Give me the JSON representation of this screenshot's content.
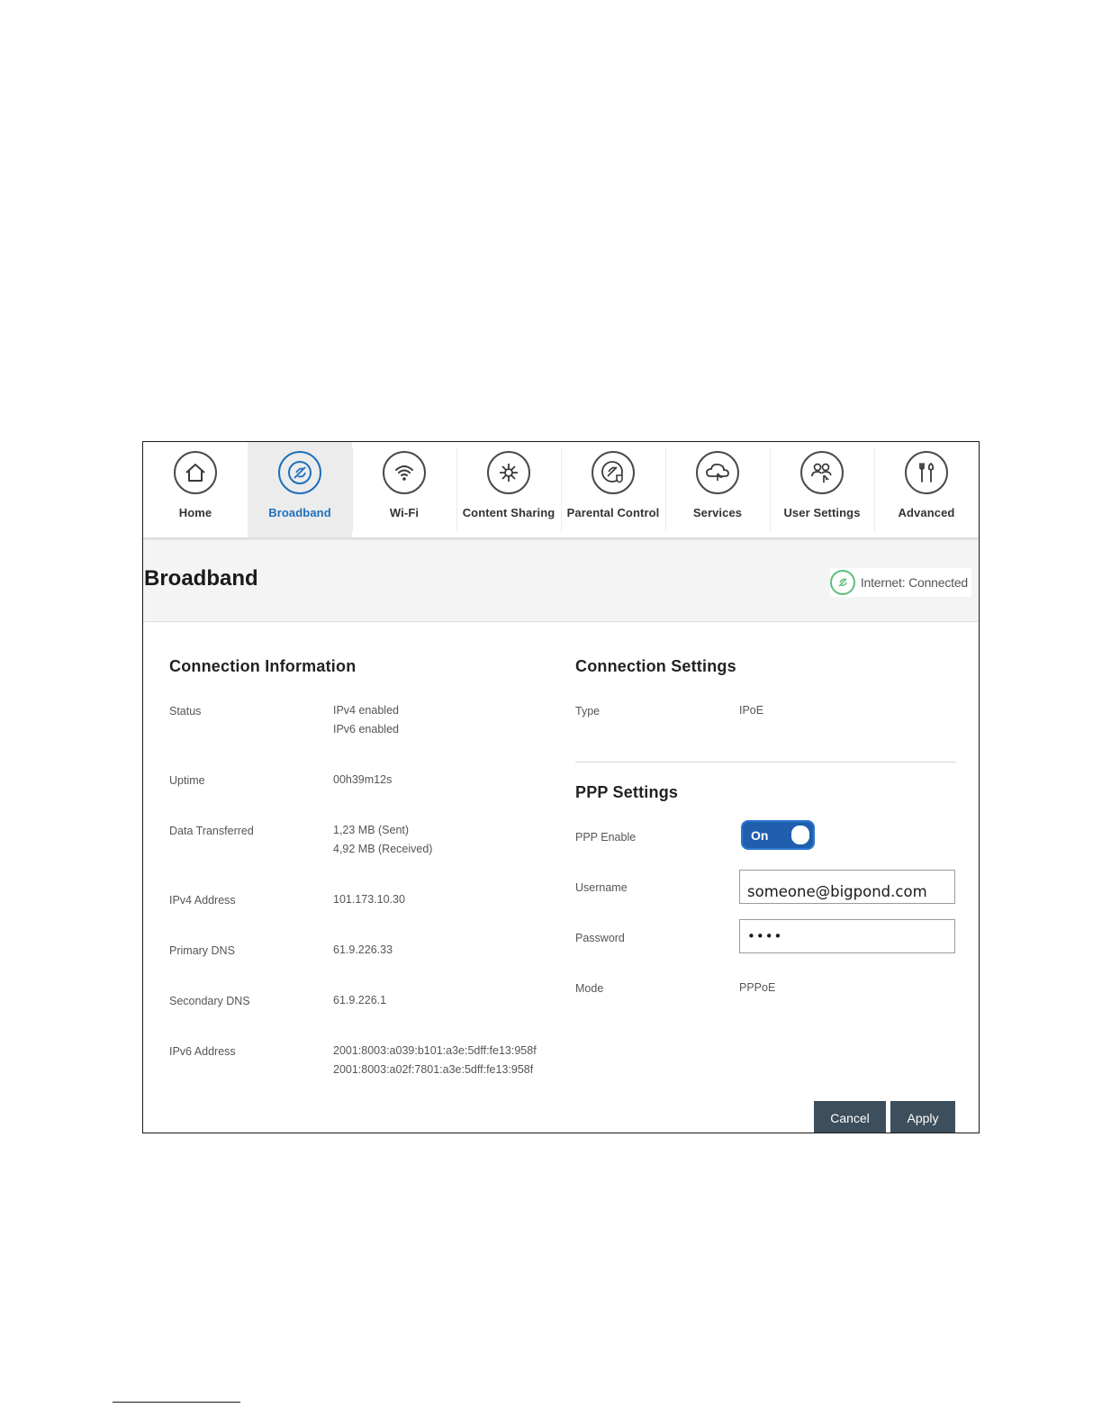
{
  "nav": {
    "items": [
      {
        "label": "Home",
        "icon": "home-icon",
        "active": false
      },
      {
        "label": "Broadband",
        "icon": "broadband-icon",
        "active": true
      },
      {
        "label": "Wi-Fi",
        "icon": "wifi-icon",
        "active": false
      },
      {
        "label": "Content Sharing",
        "icon": "content-sharing-icon",
        "active": false
      },
      {
        "label": "Parental Control",
        "icon": "parental-control-icon",
        "active": false
      },
      {
        "label": "Services",
        "icon": "services-icon",
        "active": false
      },
      {
        "label": "User Settings",
        "icon": "user-settings-icon",
        "active": false
      },
      {
        "label": "Advanced",
        "icon": "advanced-icon",
        "active": false
      }
    ]
  },
  "header": {
    "title": "Broadband",
    "status_text": "Internet: Connected"
  },
  "connection_info": {
    "title": "Connection Information",
    "rows": [
      {
        "label": "Status",
        "values": [
          "IPv4 enabled",
          "IPv6 enabled"
        ]
      },
      {
        "label": "Uptime",
        "values": [
          "00h39m12s"
        ]
      },
      {
        "label": "Data Transferred",
        "values": [
          "1,23 MB (Sent)",
          "4,92 MB (Received)"
        ]
      },
      {
        "label": "IPv4 Address",
        "values": [
          "101.173.10.30"
        ]
      },
      {
        "label": "Primary DNS",
        "values": [
          "61.9.226.33"
        ]
      },
      {
        "label": "Secondary DNS",
        "values": [
          "61.9.226.1"
        ]
      },
      {
        "label": "IPv6 Address",
        "values": [
          "2001:8003:a039:b101:a3e:5dff:fe13:958f",
          "2001:8003:a02f:7801:a3e:5dff:fe13:958f"
        ]
      }
    ]
  },
  "connection_settings": {
    "title": "Connection Settings",
    "type_label": "Type",
    "type_value": "IPoE"
  },
  "ppp_settings": {
    "title": "PPP Settings",
    "enable_label": "PPP Enable",
    "enable_state": "On",
    "username_label": "Username",
    "username_value": "someone@bigpond.com",
    "password_label": "Password",
    "password_value": "••••",
    "mode_label": "Mode",
    "mode_value": "PPPoE"
  },
  "actions": {
    "cancel": "Cancel",
    "apply": "Apply"
  },
  "colors": {
    "accent": "#1f6fba",
    "connected": "#5bbf7a",
    "button": "#3d4f5c"
  }
}
